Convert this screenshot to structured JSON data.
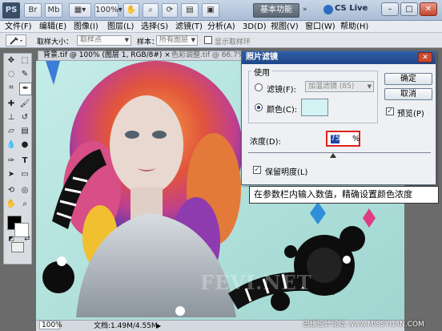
{
  "titlebar": {
    "app_logo": "PS",
    "workspace_button": "基本功能",
    "cs_live": "CS Live",
    "window_buttons": [
      "minimize-icon",
      "maximize-icon",
      "close-icon"
    ]
  },
  "menu": {
    "items": [
      {
        "label": "文件(F)"
      },
      {
        "label": "编辑(E)"
      },
      {
        "label": "图像(I)"
      },
      {
        "label": "图层(L)"
      },
      {
        "label": "选择(S)"
      },
      {
        "label": "滤镜(T)"
      },
      {
        "label": "分析(A)"
      },
      {
        "label": "3D(D)"
      },
      {
        "label": "视图(V)"
      },
      {
        "label": "窗口(W)"
      },
      {
        "label": "帮助(H)"
      }
    ]
  },
  "options_bar": {
    "sample_size_label": "取样大小：",
    "sample_size_value": "取样点",
    "sample_label": "样本：",
    "sample_value": "所有图层",
    "show_ring_label": "显示取样环"
  },
  "document": {
    "tab_title": "背景.tif @ 100% (图层 1, RGB/8#) ×",
    "tab_title_2": "色彩调整.tif @ 66.7% (RGB/8)",
    "zoom": "100%",
    "status": "文档:1.49M/4.55M"
  },
  "dialog": {
    "title": "照片滤镜",
    "use_label": "使用",
    "filter_radio_label": "滤镜(F):",
    "filter_value": "加温滤镜 (85)",
    "color_radio_label": "颜色(C):",
    "density_label": "浓度(D):",
    "density_value": "75",
    "density_unit": "%",
    "preserve_label": "保留明度(L)",
    "ok_button": "确定",
    "cancel_button": "取消",
    "preview_label": "预览(P)",
    "selected_color": "#d3f3f5"
  },
  "annotation": {
    "callout": "在参数栏内输入数值，精确设置颜色浓度",
    "watermark": "FEVI.NET",
    "corner_watermark": "思缘设计论坛  www.MISSYUAN.COM"
  },
  "colors": {
    "highlight_red": "#e0211b",
    "title_blue": "#1e4587"
  }
}
